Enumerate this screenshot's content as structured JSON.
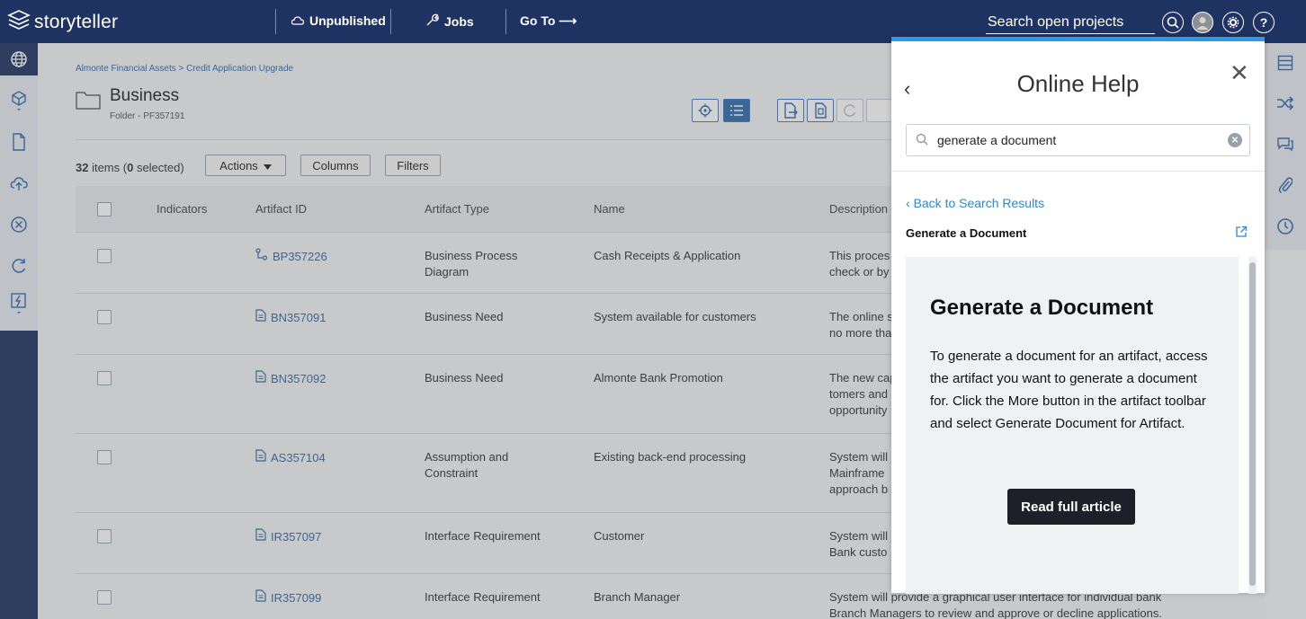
{
  "topbar": {
    "logo": "storyteller",
    "unpublished": "Unpublished",
    "jobs": "Jobs",
    "goto": "Go To ⟶",
    "search_placeholder": "Search open projects",
    "help_icon_glyph": "?"
  },
  "page": {
    "breadcrumb": "Almonte Financial Assets > Credit Application Upgrade",
    "title": "Business",
    "subtitle": "Folder - PF357191"
  },
  "list": {
    "count": "32",
    "count_suffix": " items (",
    "selected": "0",
    "selected_suffix": " selected)",
    "actions": "Actions",
    "columns": "Columns",
    "filters": "Filters"
  },
  "table": {
    "headers": [
      "Indicators",
      "Artifact ID",
      "Artifact Type",
      "Name",
      "Description"
    ],
    "rows": [
      {
        "id": "BP357226",
        "type": "Business Process Diagram",
        "name": "Cash Receipts & Application",
        "desc": "This process ... check or by ..."
      },
      {
        "id": "BN357091",
        "type": "Business Need",
        "name": "System available for customers",
        "desc": "The online s... no more tha..."
      },
      {
        "id": "BN357092",
        "type": "Business Need",
        "name": "Almonte Bank Promotion",
        "desc": "The new cap... tomers and ... opportunity..."
      },
      {
        "id": "AS357104",
        "type": "Assumption and Constraint",
        "name": "Existing back-end processing",
        "desc": "System will ... Mainframe ... approach b..."
      },
      {
        "id": "IR357097",
        "type": "Interface Requirement",
        "name": "Customer",
        "desc": "System will ... Bank custo..."
      },
      {
        "id": "IR357099",
        "type": "Interface Requirement",
        "name": "Branch Manager",
        "desc": "System will provide a graphical user interface for individual bank Branch Managers to review and approve or decline applications."
      }
    ]
  },
  "desc_lines": {
    "r1": [
      "This proces",
      "check or by"
    ],
    "r2": [
      "The online s",
      "no more tha"
    ],
    "r3": [
      "The new cap",
      "tomers and",
      "opportunity"
    ],
    "r4": [
      "System will",
      "Mainframe",
      "approach b"
    ],
    "r5": [
      "System will",
      "Bank custo"
    ],
    "r6": [
      "System will provide a graphical user interface for individual bank",
      "Branch Managers to review and approve or decline applications."
    ]
  },
  "type_lines": {
    "r1": [
      "Business Process",
      "Diagram"
    ],
    "r4": [
      "Assumption and",
      "Constraint"
    ]
  },
  "help": {
    "title": "Online Help",
    "query": "generate a document",
    "back_link": "Back to Search Results",
    "article_title": "Generate a Document",
    "card_heading": "Generate a Document",
    "card_body": "To generate a document for an artifact, access the artifact you want to generate a document for. Click the More button in the artifact toolbar and select Generate Document for Artifact.",
    "read_button": "Read full article"
  },
  "colors": {
    "navy": "#1f3363",
    "link": "#2f6bb0",
    "help_accent": "#2e9ae0",
    "button_dark": "#1d2029"
  }
}
